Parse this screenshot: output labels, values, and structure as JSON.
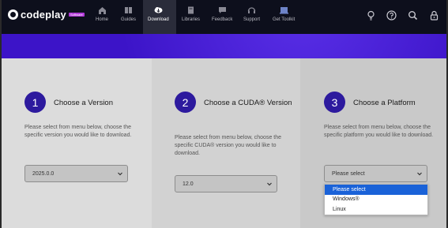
{
  "brand": {
    "name": "codeplay",
    "badge": "Software"
  },
  "nav": {
    "items": [
      {
        "label": "Home",
        "icon": "home-icon"
      },
      {
        "label": "Guides",
        "icon": "book-icon"
      },
      {
        "label": "Download",
        "icon": "cloud-download-icon",
        "active": true
      },
      {
        "label": "Libraries",
        "icon": "library-icon"
      },
      {
        "label": "Feedback",
        "icon": "feedback-icon"
      },
      {
        "label": "Support",
        "icon": "support-icon"
      },
      {
        "label": "Get Toolkit",
        "icon": "toolkit-icon"
      }
    ],
    "right_icons": [
      "lightbulb-icon",
      "help-icon",
      "search-icon",
      "lock-icon"
    ]
  },
  "colors": {
    "accent": "#3c14c8",
    "step": "#2d1a9e",
    "nav_bg": "#0d0f1c",
    "highlight": "#1a62d8"
  },
  "steps": [
    {
      "number": "1",
      "title": "Choose a Version",
      "description": "Please select from menu below, choose the specific version you would like to download.",
      "select_value": "2025.0.0"
    },
    {
      "number": "2",
      "title": "Choose a CUDA® Version",
      "description": "Please select from menu below, choose the specific CUDA® version you would like to download.",
      "select_value": "12.0"
    },
    {
      "number": "3",
      "title": "Choose a Platform",
      "description": "Please select from menu below, choose the specific platform you would like to download.",
      "select_value": "Please select"
    }
  ],
  "platform_dropdown": {
    "options": [
      "Please select",
      "Windows®",
      "Linux"
    ],
    "highlighted": "Please select"
  }
}
